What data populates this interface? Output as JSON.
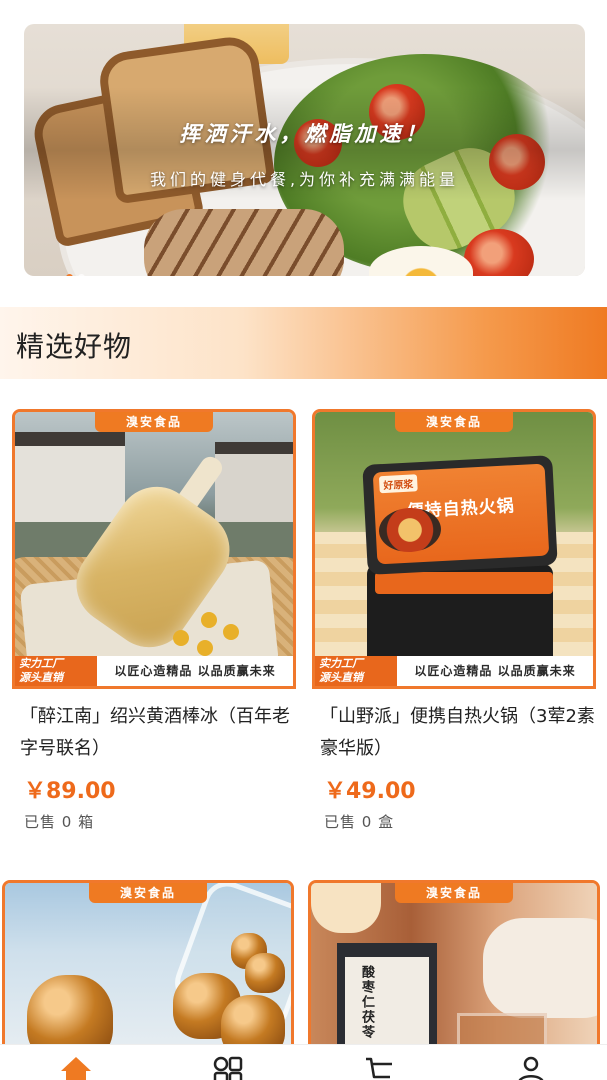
{
  "banner": {
    "title": "挥洒汗水，燃脂加速！",
    "subtitle": "我们的健身代餐,为你补充满满能量",
    "dot_count": 2,
    "active_dot": 0
  },
  "section": {
    "title": "精选好物"
  },
  "products": [
    {
      "tag_top": "溴安食品",
      "tag_left": "实力工厂\n源头直销",
      "tag_right": "以匠心造精品 以品质赢未来",
      "name": "「醉江南」绍兴黄酒棒冰（百年老字号联名）",
      "price": "￥89.00",
      "sold": "已售 0 箱"
    },
    {
      "tag_top": "溴安食品",
      "tag_left": "实力工厂\n源头直销",
      "tag_right": "以匠心造精品 以品质赢未来",
      "name": "「山野派」便携自热火锅（3荤2素豪华版）",
      "price": "￥49.00",
      "sold": "已售 0 盒",
      "package_brand": "好原浆",
      "package_title": "便持自热火锅"
    },
    {
      "tag_top": "溴安食品"
    },
    {
      "tag_top": "溴安食品",
      "package_text": "酸枣仁茯苓"
    }
  ],
  "tabbar": {
    "items": [
      {
        "icon": "home-icon",
        "active": true
      },
      {
        "icon": "category-icon",
        "active": false
      },
      {
        "icon": "cart-icon",
        "active": false
      },
      {
        "icon": "profile-icon",
        "active": false
      }
    ]
  },
  "colors": {
    "accent": "#ef7a22",
    "price": "#ee6a1b",
    "text": "#222222"
  }
}
